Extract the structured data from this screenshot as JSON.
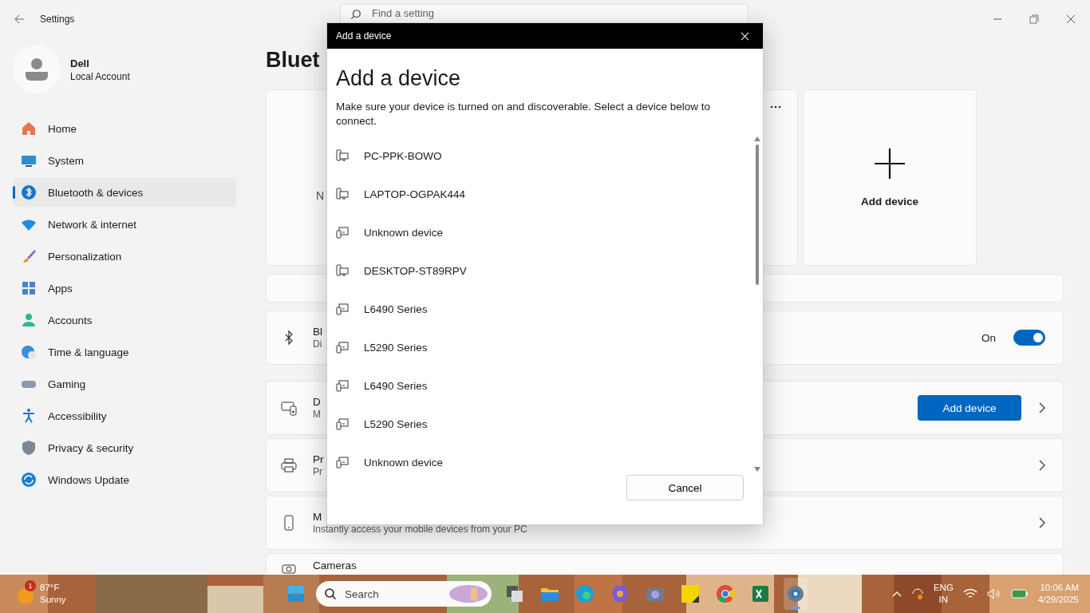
{
  "app_title": "Settings",
  "search": {
    "placeholder": "Find a setting"
  },
  "profile": {
    "name": "Dell",
    "account": "Local Account"
  },
  "nav": [
    {
      "label": "Home",
      "selected": false
    },
    {
      "label": "System",
      "selected": false
    },
    {
      "label": "Bluetooth & devices",
      "selected": true
    },
    {
      "label": "Network & internet",
      "selected": false
    },
    {
      "label": "Personalization",
      "selected": false
    },
    {
      "label": "Apps",
      "selected": false
    },
    {
      "label": "Accounts",
      "selected": false
    },
    {
      "label": "Time & language",
      "selected": false
    },
    {
      "label": "Gaming",
      "selected": false
    },
    {
      "label": "Accessibility",
      "selected": false
    },
    {
      "label": "Privacy & security",
      "selected": false
    },
    {
      "label": "Windows Update",
      "selected": false
    }
  ],
  "page_heading": "Bluet",
  "cards": [
    {
      "kind": "device",
      "label": "N"
    },
    {
      "kind": "add",
      "label": "Add device"
    }
  ],
  "rows": [
    {
      "kind": "blank"
    },
    {
      "kind": "toggle",
      "title": "Bl",
      "subtitle": "Di",
      "state_label": "On",
      "on": true
    },
    {
      "kind": "button",
      "title": "D",
      "subtitle": "M",
      "button": "Add device"
    },
    {
      "kind": "link",
      "title": "Pr",
      "subtitle": "Pr"
    },
    {
      "kind": "link",
      "title": "M",
      "subtitle": "Instantly access your mobile devices from your PC"
    },
    {
      "kind": "partial",
      "title": "Cameras"
    }
  ],
  "dialog": {
    "window_title": "Add a device",
    "heading": "Add a device",
    "description": "Make sure your device is turned on and discoverable. Select a device below to connect.",
    "devices": [
      {
        "name": "PC-PPK-BOWO",
        "kind": "computer"
      },
      {
        "name": "LAPTOP-OGPAK444",
        "kind": "computer"
      },
      {
        "name": "Unknown device",
        "kind": "other"
      },
      {
        "name": "DESKTOP-ST89RPV",
        "kind": "computer"
      },
      {
        "name": "L6490 Series",
        "kind": "other"
      },
      {
        "name": "L5290 Series",
        "kind": "other"
      },
      {
        "name": "L6490 Series",
        "kind": "other"
      },
      {
        "name": "L5290 Series",
        "kind": "other"
      },
      {
        "name": "Unknown device",
        "kind": "other"
      }
    ],
    "cancel": "Cancel"
  },
  "taskbar": {
    "weather": {
      "badge": "1",
      "temperature": "87°F",
      "condition": "Sunny"
    },
    "search": {
      "placeholder": "Search"
    },
    "apps": [
      {
        "active": false
      },
      {
        "active": false
      },
      {
        "active": false
      },
      {
        "active": false
      },
      {
        "active": false
      },
      {
        "active": false
      },
      {
        "active": false
      },
      {
        "active": false
      },
      {
        "active": true
      }
    ],
    "tray": {
      "language": "ENG",
      "region": "IN",
      "time": "10:06 AM",
      "date": "4/29/2025"
    }
  }
}
